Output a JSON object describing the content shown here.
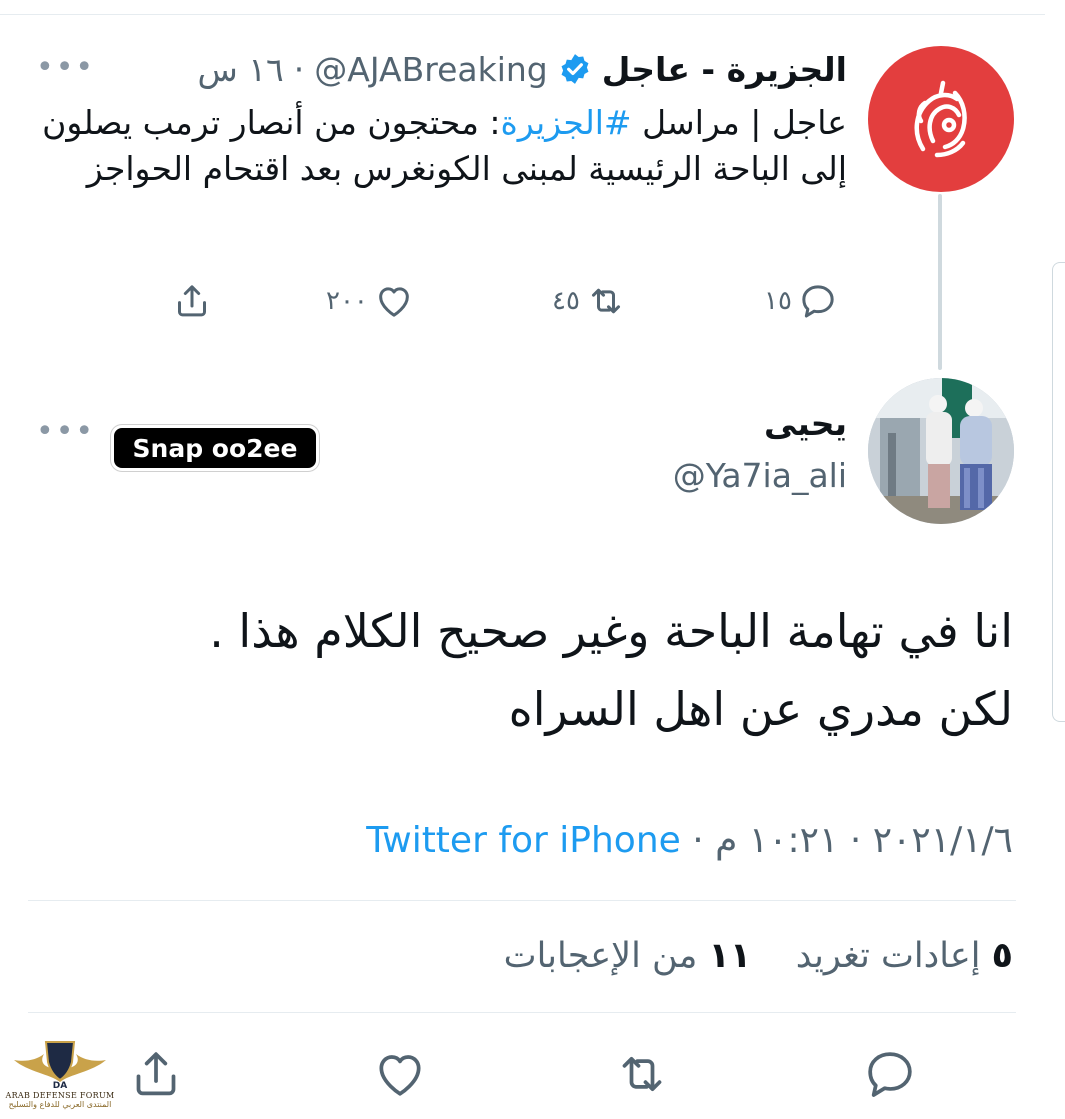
{
  "colors": {
    "brand_red": "#e33e3e",
    "link_blue": "#1d9bf0",
    "muted": "#536471",
    "text": "#0f1419"
  },
  "quoted_tweet": {
    "display_name": "الجزيرة - عاجل",
    "handle": "@AJABreaking",
    "time": "١٦ س",
    "separator": "·",
    "verified_icon": "verified-badge-icon",
    "more_icon": "ellipsis-icon",
    "text_before_tag": "عاجل | مراسل ",
    "hashtag": "#الجزيرة",
    "text_after_tag": ": محتجون من أنصار ترمب يصلون إلى الباحة الرئيسية لمبنى الكونغرس بعد اقتحام الحواجز",
    "actions": {
      "reply_count": "١٥",
      "retweet_count": "٤٥",
      "like_count": "٢٠٠"
    }
  },
  "tweet": {
    "display_name": "يحيى",
    "handle": "@Ya7ia_ali",
    "more_icon": "ellipsis-icon",
    "snap_badge": "Snap oo2ee",
    "text_line1": "انا في تهامة الباحة وغير صحيح الكلام هذا .",
    "text_line2": "لكن مدري عن اهل السراه",
    "date": "٢٠٢١/١/٦",
    "time": "١٠:٢١ م",
    "meta_separator": "·",
    "source": "Twitter for iPhone",
    "retweets_count": "٥",
    "retweets_label": "إعادات تغريد",
    "likes_count": "١١",
    "likes_label": "من الإعجابات"
  },
  "watermark": {
    "logo_badge": "DA",
    "name_en": "ARAB DEFENSE FORUM",
    "name_ar": "المنتدى العربي للدفاع والتسليح"
  }
}
